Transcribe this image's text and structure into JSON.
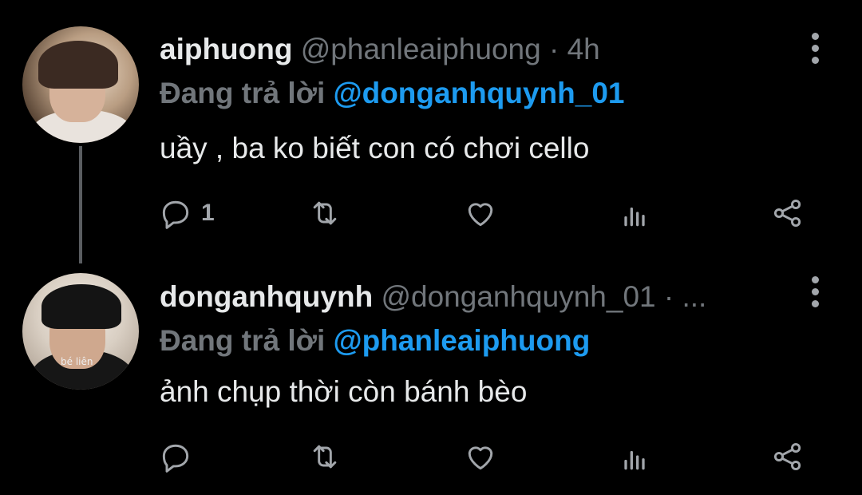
{
  "tweets": [
    {
      "display_name": "aiphuong",
      "handle": "@phanleaiphuong",
      "separator": "·",
      "time": "4h",
      "reply_prefix": "Đang trả lời",
      "reply_to": "@donganhquynh_01",
      "text": "uầy , ba ko biết con có chơi cello",
      "reply_count": "1",
      "avatar_icon": "profile-photo"
    },
    {
      "display_name": "donganhquynh",
      "handle": "@donganhquynh_01",
      "separator": "·",
      "time": "...",
      "reply_prefix": "Đang trả lời",
      "reply_to": "@phanleaiphuong",
      "text": "ảnh chụp thời còn bánh bèo",
      "reply_count": "",
      "avatar_icon": "profile-photo",
      "avatar_shirt_text": "bé liên"
    }
  ],
  "colors": {
    "background": "#000000",
    "primary_text": "#e7e9ea",
    "secondary_text": "#71767b",
    "mention": "#1d9bf0",
    "icon": "#a2a6ab",
    "thread_line": "#5a5d61"
  },
  "action_icons": [
    "reply-icon",
    "retweet-icon",
    "like-icon",
    "views-icon",
    "share-icon"
  ]
}
